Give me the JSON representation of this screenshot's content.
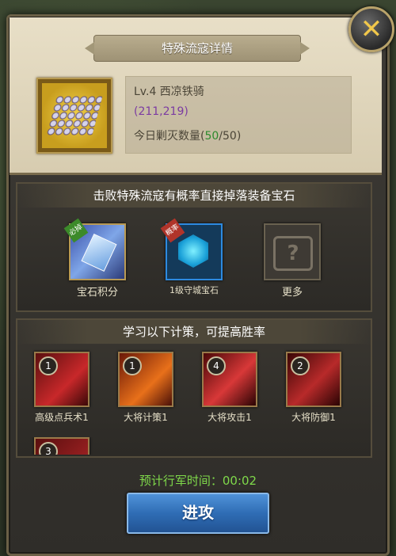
{
  "dialog": {
    "title": "特殊流寇详情",
    "close_icon": "close-x-icon"
  },
  "enemy": {
    "level_name": "Lv.4 西凉铁骑",
    "coordinates": "(211,219)",
    "kills_label": "今日剿灭数量(",
    "kills_current": "50",
    "kills_total": "/50)"
  },
  "rewards": {
    "header": "击败特殊流寇有概率直接掉落装备宝石",
    "items": [
      {
        "label": "宝石积分",
        "badge": "必掉",
        "icon": "gem-points-icon"
      },
      {
        "label": "1级守城宝石",
        "badge": "概率",
        "icon": "defense-gem-icon"
      },
      {
        "label": "更多",
        "badge": "",
        "icon": "more-chest-icon"
      }
    ]
  },
  "skills": {
    "header": "学习以下计策，可提高胜率",
    "items": [
      {
        "label": "高级点兵术1",
        "level": "1"
      },
      {
        "label": "大将计策1",
        "level": "1"
      },
      {
        "label": "大将攻击1",
        "level": "4"
      },
      {
        "label": "大将防御1",
        "level": "2"
      },
      {
        "label": "",
        "level": "3"
      }
    ]
  },
  "march": {
    "label": "预计行军时间：00:02"
  },
  "attack_button": {
    "label": "进攻"
  },
  "colors": {
    "green": "#2d8a2d",
    "purple": "#7b3ba2",
    "march_green": "#7fd94a",
    "button_blue": "#2f6db5"
  }
}
